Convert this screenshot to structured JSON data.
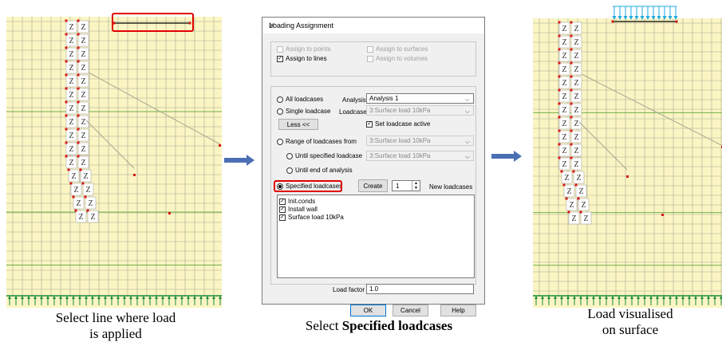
{
  "left_panel": {
    "wall_label": "Z"
  },
  "right_panel": {
    "wall_label": "Z"
  },
  "captions": {
    "left_line1": "Select line where load",
    "left_line2": "is applied",
    "middle_prefix": "Select ",
    "middle_bold": "Specified loadcases",
    "right_line1": "Load visualised",
    "right_line2": "on surface"
  },
  "dialog": {
    "title": "Loading Assignment",
    "close_glyph": "×",
    "assign": {
      "points": "Assign to points",
      "surfaces": "Assign to surfaces",
      "lines": "Assign to lines",
      "volumes": "Assign to volumes",
      "lines_checked": true
    },
    "all_loadcases": "All loadcases",
    "analysis_label": "Analysis",
    "analysis_value": "Analysis 1",
    "single_loadcase": "Single loadcase",
    "loadcase_label": "Loadcase",
    "loadcase_value": "3:Surface load 10kPa",
    "less_button": "Less <<",
    "set_active": "Set loadcase active",
    "range_from": "Range of loadcases from",
    "range_from_value": "3:Surface load 10kPa",
    "until_specified": "Until specified loadcase",
    "until_specified_value": "3:Surface load 10kPa",
    "until_end": "Until end of analysis",
    "specified_loadcases": "Specified loadcases",
    "create_button": "Create",
    "create_count": "1",
    "new_loadcases": "New loadcases",
    "loadcases": [
      {
        "label": "Init.conds",
        "checked": true
      },
      {
        "label": "Install wall",
        "checked": true
      },
      {
        "label": "Surface load 10kPa",
        "checked": true
      }
    ],
    "load_factor_label": "Load factor",
    "load_factor_value": "1.0",
    "ok_button": "OK",
    "cancel_button": "Cancel",
    "help_button": "Help"
  },
  "colors": {
    "mesh_bg": "#fbf5c4",
    "mesh_line": "#a8a890",
    "green_line": "#6fb04a",
    "support": "#1a8a3a",
    "node_red": "#d81818",
    "load_arrow": "#20a8e0",
    "highlight": "#e00000",
    "transition_arrow": "#4a6fb5"
  }
}
